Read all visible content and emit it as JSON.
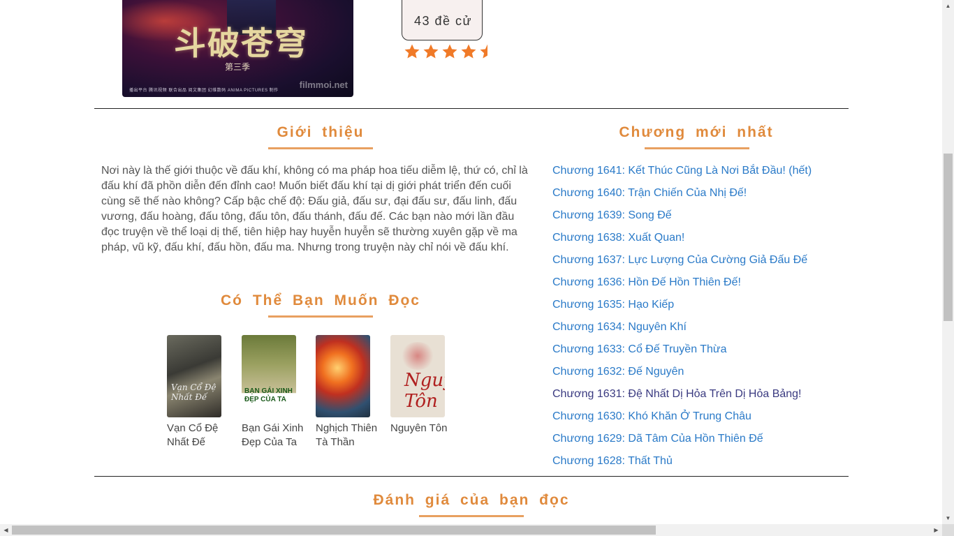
{
  "cover": {
    "title": "斗破苍穹",
    "season": "第三季",
    "sponsor": "播出平台 腾讯视频 联合出品 阅文集团 幻维数码 ANIMA PICTURES 制作",
    "watermark": "filmmoi.net"
  },
  "nominate": {
    "text": "43 đề cử"
  },
  "rating": {
    "stars": 4.5,
    "max": 5,
    "color": "#f07a28"
  },
  "intro": {
    "heading": "Giới thiệu",
    "text": "Nơi này là thế giới thuộc về đấu khí, không có ma pháp hoa tiếu diễm lệ, thứ có, chỉ là đấu khí đã phồn diễn đến đỉnh cao! Muốn biết đấu khí tại dị giới phát triển đến cuối cùng sẽ thế nào không? Cấp bậc chế độ: Đấu giả, đấu sư, đại đấu sư, đấu linh, đấu vương, đấu hoàng, đấu tông, đấu tôn, đấu thánh, đấu đế. Các bạn nào mới lần đầu đọc truyện về thể loại dị thế, tiên hiệp hay huyễn huyễn sẽ thường xuyên gặp về ma pháp, vũ kỹ, đấu khí, đấu hồn, đấu ma. Nhưng trong truyện này chỉ nói về đấu khí."
  },
  "suggest": {
    "heading": "Có Thể Bạn Muốn Đọc",
    "books": [
      {
        "title": "Vạn Cổ Đệ Nhất Đế",
        "cover_text": "Vạn Cổ Đệ Nhất Đế"
      },
      {
        "title": "Bạn Gái Xinh Đẹp Của Ta",
        "cover_text": "BẠN GÁI XINH ĐẸP CỦA TA"
      },
      {
        "title": "Nghịch Thiên Tà Thần",
        "cover_text": ""
      },
      {
        "title": "Nguyên Tôn",
        "cover_text": "Nguyên Tôn"
      }
    ]
  },
  "latest": {
    "heading": "Chương mới nhất",
    "chapters": [
      {
        "label": "Chương 1641: Kết Thúc Cũng Là Nơi Bắt Đầu! (hết)",
        "visited": false
      },
      {
        "label": "Chương 1640: Trận Chiến Của Nhị Đế!",
        "visited": false
      },
      {
        "label": "Chương 1639: Song Đế",
        "visited": false
      },
      {
        "label": "Chương 1638: Xuất Quan!",
        "visited": false
      },
      {
        "label": "Chương 1637: Lực Lượng Của Cường Giả Đấu Đế",
        "visited": false
      },
      {
        "label": "Chương 1636: Hồn Đế Hồn Thiên Đế!",
        "visited": false
      },
      {
        "label": "Chương 1635: Hạo Kiếp",
        "visited": false
      },
      {
        "label": "Chương 1634: Nguyên Khí",
        "visited": false
      },
      {
        "label": "Chương 1633: Cổ Đế Truyền Thừa",
        "visited": false
      },
      {
        "label": "Chương 1632: Đế Nguyên",
        "visited": false
      },
      {
        "label": "Chương 1631: Đệ Nhất Dị Hỏa Trên Dị Hỏa Bảng!",
        "visited": true
      },
      {
        "label": "Chương 1630: Khó Khăn Ở Trung Châu",
        "visited": false
      },
      {
        "label": "Chương 1629: Dã Tâm Của Hồn Thiên Đế",
        "visited": false
      },
      {
        "label": "Chương 1628: Thất Thủ",
        "visited": false
      }
    ]
  },
  "reviews": {
    "heading": "Đánh giá của bạn đọc"
  },
  "colors": {
    "heading": "#e08a3c",
    "link": "#2a7ac8",
    "visited_link": "#3a3a80",
    "underline": "#e8a060"
  }
}
